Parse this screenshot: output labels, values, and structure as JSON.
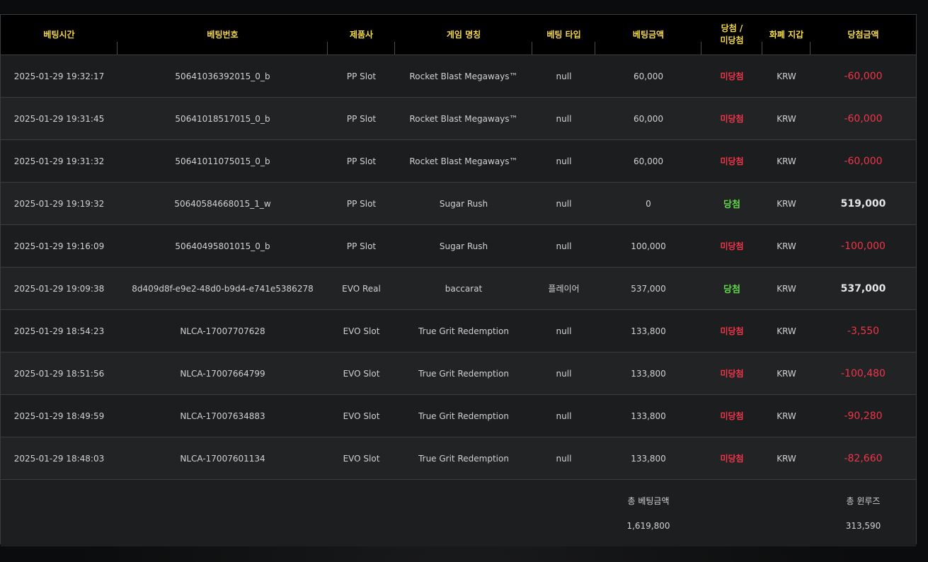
{
  "headers": {
    "bet_time": "베팅시간",
    "bet_no": "베팅번호",
    "vendor": "제품사",
    "game": "게임 명칭",
    "bet_type": "베팅 타입",
    "bet_amount": "베팅금액",
    "result_line1": "당첨 /",
    "result_line2": "미당첨",
    "currency": "화폐 지갑",
    "win_amount": "당첨금액"
  },
  "rows": [
    {
      "time": "2025-01-29 19:32:17",
      "bet_no": "50641036392015_0_b",
      "vendor": "PP Slot",
      "game": "Rocket Blast Megaways™",
      "bet_type": "null",
      "amount": "60,000",
      "result": "미당첨",
      "currency": "KRW",
      "win": "-60,000"
    },
    {
      "time": "2025-01-29 19:31:45",
      "bet_no": "50641018517015_0_b",
      "vendor": "PP Slot",
      "game": "Rocket Blast Megaways™",
      "bet_type": "null",
      "amount": "60,000",
      "result": "미당첨",
      "currency": "KRW",
      "win": "-60,000"
    },
    {
      "time": "2025-01-29 19:31:32",
      "bet_no": "50641011075015_0_b",
      "vendor": "PP Slot",
      "game": "Rocket Blast Megaways™",
      "bet_type": "null",
      "amount": "60,000",
      "result": "미당첨",
      "currency": "KRW",
      "win": "-60,000"
    },
    {
      "time": "2025-01-29 19:19:32",
      "bet_no": "50640584668015_1_w",
      "vendor": "PP Slot",
      "game": "Sugar Rush",
      "bet_type": "null",
      "amount": "0",
      "result": "당첨",
      "currency": "KRW",
      "win": "519,000"
    },
    {
      "time": "2025-01-29 19:16:09",
      "bet_no": "50640495801015_0_b",
      "vendor": "PP Slot",
      "game": "Sugar Rush",
      "bet_type": "null",
      "amount": "100,000",
      "result": "미당첨",
      "currency": "KRW",
      "win": "-100,000"
    },
    {
      "time": "2025-01-29 19:09:38",
      "bet_no": "8d409d8f-e9e2-48d0-b9d4-e741e5386278",
      "vendor": "EVO Real",
      "game": "baccarat",
      "bet_type": "플레이어",
      "amount": "537,000",
      "result": "당첨",
      "currency": "KRW",
      "win": "537,000"
    },
    {
      "time": "2025-01-29 18:54:23",
      "bet_no": "NLCA-17007707628",
      "vendor": "EVO Slot",
      "game": "True Grit Redemption",
      "bet_type": "null",
      "amount": "133,800",
      "result": "미당첨",
      "currency": "KRW",
      "win": "-3,550"
    },
    {
      "time": "2025-01-29 18:51:56",
      "bet_no": "NLCA-17007664799",
      "vendor": "EVO Slot",
      "game": "True Grit Redemption",
      "bet_type": "null",
      "amount": "133,800",
      "result": "미당첨",
      "currency": "KRW",
      "win": "-100,480"
    },
    {
      "time": "2025-01-29 18:49:59",
      "bet_no": "NLCA-17007634883",
      "vendor": "EVO Slot",
      "game": "True Grit Redemption",
      "bet_type": "null",
      "amount": "133,800",
      "result": "미당첨",
      "currency": "KRW",
      "win": "-90,280"
    },
    {
      "time": "2025-01-29 18:48:03",
      "bet_no": "NLCA-17007601134",
      "vendor": "EVO Slot",
      "game": "True Grit Redemption",
      "bet_type": "null",
      "amount": "133,800",
      "result": "미당첨",
      "currency": "KRW",
      "win": "-82,660"
    }
  ],
  "footer": {
    "total_bet_label": "총 베팅금액",
    "total_bet_value": "1,619,800",
    "total_winloss_label": "총 윈루즈",
    "total_winloss_value": "313,590"
  },
  "colors": {
    "header_text": "#f5d94a",
    "lose": "#f0364a",
    "win": "#62d64a"
  }
}
